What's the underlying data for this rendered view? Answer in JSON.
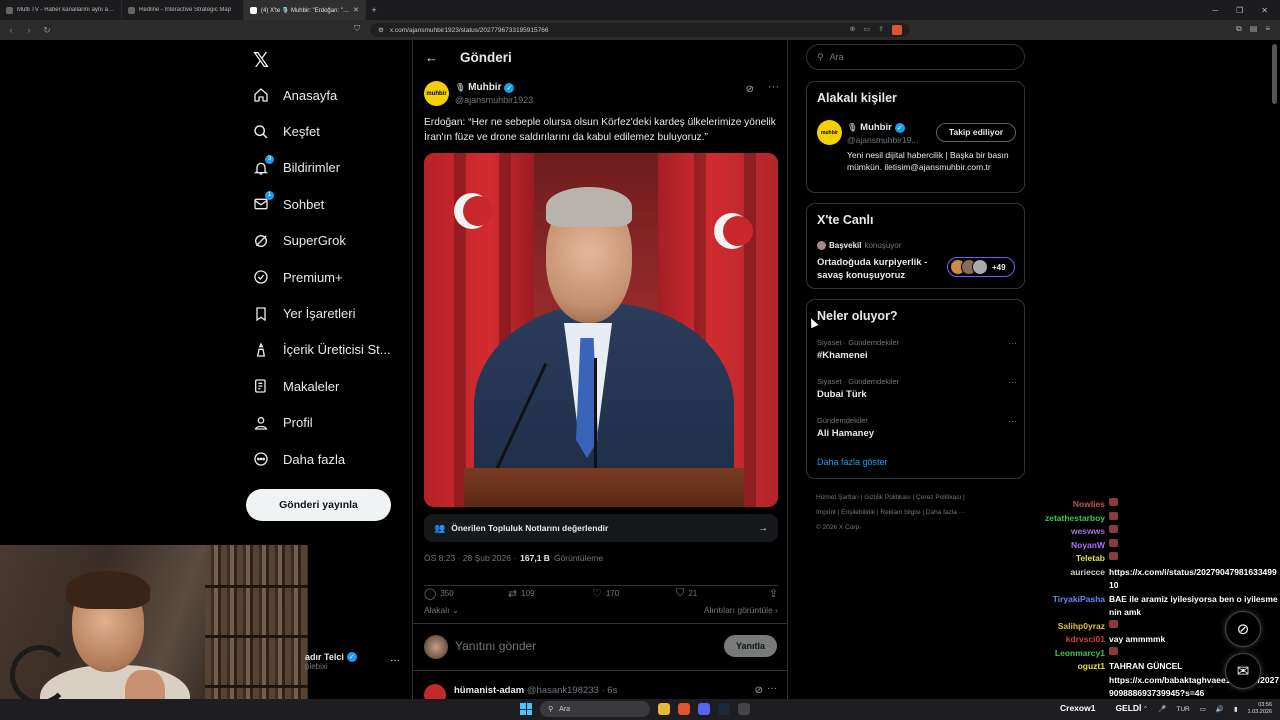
{
  "browser": {
    "tabs": [
      {
        "title": "Multi TV - Haber kanallarını aynı anda",
        "active": false
      },
      {
        "title": "Redline - Interactive Strategic Map",
        "active": false
      },
      {
        "title": "(4) X'te 🎙️ Muhbir: \"Erdoğan: \"Her",
        "active": true
      }
    ],
    "url": "x.com/ajansmuhbir1923/status/2027796733195915766"
  },
  "nav": {
    "items": [
      {
        "label": "Anasayfa",
        "icon": "home-icon",
        "badge": ""
      },
      {
        "label": "Keşfet",
        "icon": "search-icon",
        "badge": ""
      },
      {
        "label": "Bildirimler",
        "icon": "bell-icon",
        "badge": "3"
      },
      {
        "label": "Sohbet",
        "icon": "mail-icon",
        "badge": "1"
      },
      {
        "label": "SuperGrok",
        "icon": "grok-icon",
        "badge": ""
      },
      {
        "label": "Premium+",
        "icon": "premium-icon",
        "badge": ""
      },
      {
        "label": "Yer İşaretleri",
        "icon": "bookmark-icon",
        "badge": ""
      },
      {
        "label": "İçerik Üreticisi St...",
        "icon": "creator-icon",
        "badge": ""
      },
      {
        "label": "Makaleler",
        "icon": "articles-icon",
        "badge": ""
      },
      {
        "label": "Profil",
        "icon": "profile-icon",
        "badge": ""
      },
      {
        "label": "Daha fazla",
        "icon": "more-circle-icon",
        "badge": ""
      }
    ],
    "post_button": "Gönderi yayınla",
    "account_name": "adır Telci",
    "account_handle": "plebixi"
  },
  "main": {
    "header_title": "Gönderi",
    "tweet": {
      "avatar_text": "muhbir",
      "name": "Muhbir",
      "handle": "@ajansmuhbir1923",
      "text": "Erdoğan: “Her ne sebeple olursa olsun Körfez'deki kardeş ülkelerimize yönelik İran'ın füze ve drone saldırılarını da kabul edilemez buluyoruz.”",
      "notes_prompt": "Önerilen Topluluk Notlarını değerlendir",
      "time": "ÖS 8:23 · 28 Şub 2026 ·",
      "views_count": "167,1 B",
      "views_label": "Görüntüleme",
      "replies": "350",
      "retweets": "109",
      "likes": "170",
      "bookmarks": "21",
      "sort_label": "Alakalı",
      "quotes_label": "Alıntıları görüntüle"
    },
    "reply_placeholder": "Yanıtını gönder",
    "reply_button": "Yanıtla",
    "next_reply": {
      "name": "hümanist-adam",
      "handle": "@hasank198233",
      "time": "· 6s"
    }
  },
  "sidebar": {
    "search_placeholder": "Ara",
    "related": {
      "title": "Alakalı kişiler",
      "name": "Muhbir",
      "handle": "@ajansmuhbir19...",
      "follow_label": "Takip ediliyor",
      "bio": "Yeni nesil dijital habercilik | Başka bir basın mümkün. iletisim@ajansmuhbir.com.tr"
    },
    "live": {
      "title": "X'te Canlı",
      "host": "Başvekil",
      "host_status": "konuşuyor",
      "topic": "Ortadoğuda kurpiyerlik - savaş konuşuyoruz",
      "count": "+49"
    },
    "trends": {
      "title": "Neler oluyor?",
      "items": [
        {
          "category": "Siyaset · Gündemdekiler",
          "name": "#Khamenei"
        },
        {
          "category": "Siyaset · Gündemdekiler",
          "name": "Dubai Türk"
        },
        {
          "category": "Gündemdekiler",
          "name": "Ali Hamaney"
        }
      ],
      "show_more": "Daha fazla göster"
    },
    "footer": {
      "line1": "Hizmet Şartları  |  Gizlilik Politikası  |  Çerez Politikası  |",
      "line2": "Imprint  |  Erişilebilirlik  |  Reklam bilgisi  |  Daha fazla ···",
      "line3": "© 2026 X Corp."
    }
  },
  "chat": [
    {
      "user": "Nowlies",
      "color": "#b85450",
      "msg": "",
      "emote": true
    },
    {
      "user": "zetathestarboy",
      "color": "#3cc45a",
      "msg": "",
      "emote": true
    },
    {
      "user": "weswws",
      "color": "#a070e0",
      "msg": "",
      "emote": true
    },
    {
      "user": "NoyanW",
      "color": "#b070ff",
      "msg": "",
      "emote": true
    },
    {
      "user": "Teletab",
      "color": "#e0e040",
      "msg": "",
      "emote": true
    },
    {
      "user": "auriecce",
      "color": "#cfcfcf",
      "msg": "https://x.com/i/status/2027904798163349910",
      "emote": false
    },
    {
      "user": "TiryakiPasha",
      "color": "#5a8cff",
      "msg": "BAE ile aramiz iyilesiyorsa ben o iyilesmenin amk",
      "emote": false
    },
    {
      "user": "Salihp0yraz",
      "color": "#e0c040",
      "msg": "",
      "emote": true
    },
    {
      "user": "kdrvsci01",
      "color": "#d04040",
      "msg": "vay ammmmk",
      "emote": false
    },
    {
      "user": "Leonmarcy1",
      "color": "#3cc45a",
      "msg": "",
      "emote": true
    },
    {
      "user": "oguzt1",
      "color": "#e0e040",
      "msg": "TAHRAN GÜNCEL",
      "emote": false
    },
    {
      "user": "",
      "color": "#ffffff",
      "msg": "https://x.com/babaktaghvaee1/status/2027909888693739945?s=46",
      "emote": false
    }
  ],
  "taskbar": {
    "search": "Ara",
    "lang": "TUR",
    "time": "03:56",
    "date": "1.03.2026",
    "stream_user": "Crexow1",
    "stream_status": "GELDİ"
  },
  "colors": {
    "accent": "#1d9bf0",
    "background": "#000000",
    "border": "#2f3336",
    "muted": "#71767b",
    "grok_purple": "#7856ff"
  }
}
